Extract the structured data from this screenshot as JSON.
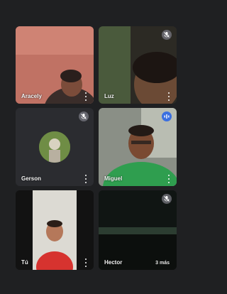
{
  "participants": [
    {
      "name": "Aracely",
      "muted": false
    },
    {
      "name": "Luz",
      "muted": true
    },
    {
      "name": "Gerson",
      "muted": true
    },
    {
      "name": "Miguel",
      "muted": false,
      "speaking": true
    },
    {
      "name": "Tú",
      "muted": false
    },
    {
      "name": "Hector",
      "muted": true
    }
  ],
  "overflow": {
    "label": "3 más"
  },
  "colors": {
    "background": "#1f2022",
    "tile": "#2b2c30",
    "speaking": "#3b6fe0"
  }
}
